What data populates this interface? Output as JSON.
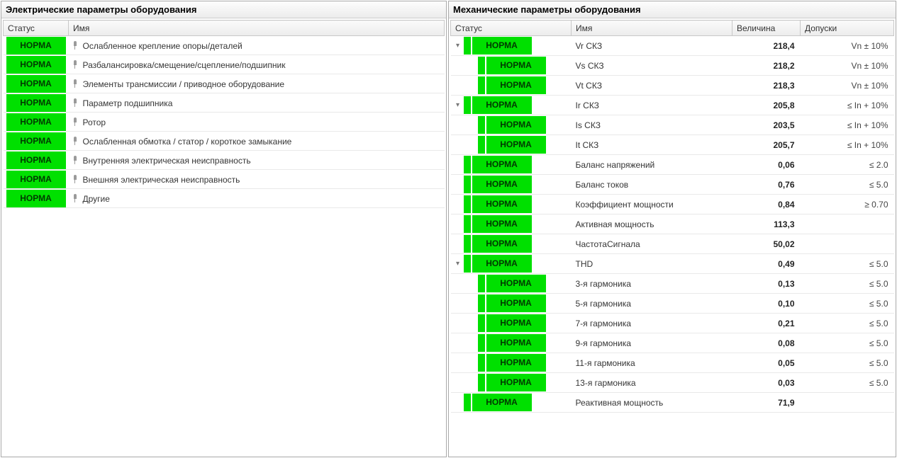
{
  "panels": {
    "left": {
      "title": "Электрические параметры оборудования",
      "columns": {
        "status": "Статус",
        "name": "Имя"
      },
      "status_label": "НОРМА",
      "rows": [
        {
          "name": "Ослабленное крепление опоры/деталей"
        },
        {
          "name": "Разбалансировка/смещение/сцепление/подшипник"
        },
        {
          "name": "Элементы трансмиссии / приводное оборудование"
        },
        {
          "name": "Параметр подшипника"
        },
        {
          "name": "Ротор"
        },
        {
          "name": "Ослабленная обмотка / статор / короткое замыкание"
        },
        {
          "name": "Внутренняя электрическая неисправность"
        },
        {
          "name": "Внешняя электрическая неисправность"
        },
        {
          "name": "Другие"
        }
      ]
    },
    "right": {
      "title": "Механические параметры оборудования",
      "columns": {
        "status": "Статус",
        "name": "Имя",
        "value": "Величина",
        "tolerance": "Допуски"
      },
      "status_label": "НОРМА",
      "rows": [
        {
          "level": 0,
          "expander": "open",
          "name": "Vr СКЗ",
          "value": "218,4",
          "tolerance": "Vn ± 10%"
        },
        {
          "level": 1,
          "expander": "",
          "name": "Vs СКЗ",
          "value": "218,2",
          "tolerance": "Vn ± 10%"
        },
        {
          "level": 1,
          "expander": "",
          "name": "Vt СКЗ",
          "value": "218,3",
          "tolerance": "Vn ± 10%"
        },
        {
          "level": 0,
          "expander": "open",
          "name": "Ir СКЗ",
          "value": "205,8",
          "tolerance": "≤ In + 10%"
        },
        {
          "level": 1,
          "expander": "",
          "name": "Is СКЗ",
          "value": "203,5",
          "tolerance": "≤ In + 10%"
        },
        {
          "level": 1,
          "expander": "",
          "name": "It СКЗ",
          "value": "205,7",
          "tolerance": "≤ In + 10%"
        },
        {
          "level": 0,
          "expander": "",
          "name": "Баланс напряжений",
          "value": "0,06",
          "tolerance": "≤ 2.0"
        },
        {
          "level": 0,
          "expander": "",
          "name": "Баланс токов",
          "value": "0,76",
          "tolerance": "≤ 5.0"
        },
        {
          "level": 0,
          "expander": "",
          "name": "Коэффициент мощности",
          "value": "0,84",
          "tolerance": "≥ 0.70"
        },
        {
          "level": 0,
          "expander": "",
          "name": "Активная мощность",
          "value": "113,3",
          "tolerance": ""
        },
        {
          "level": 0,
          "expander": "",
          "name": "ЧастотаСигнала",
          "value": "50,02",
          "tolerance": ""
        },
        {
          "level": 0,
          "expander": "open",
          "name": "THD",
          "value": "0,49",
          "tolerance": "≤ 5.0"
        },
        {
          "level": 1,
          "expander": "",
          "name": "3-я гармоника",
          "value": "0,13",
          "tolerance": "≤ 5.0"
        },
        {
          "level": 1,
          "expander": "",
          "name": "5-я гармоника",
          "value": "0,10",
          "tolerance": "≤ 5.0"
        },
        {
          "level": 1,
          "expander": "",
          "name": "7-я гармоника",
          "value": "0,21",
          "tolerance": "≤ 5.0"
        },
        {
          "level": 1,
          "expander": "",
          "name": "9-я гармоника",
          "value": "0,08",
          "tolerance": "≤ 5.0"
        },
        {
          "level": 1,
          "expander": "",
          "name": "11-я гармоника",
          "value": "0,05",
          "tolerance": "≤ 5.0"
        },
        {
          "level": 1,
          "expander": "",
          "name": "13-я гармоника",
          "value": "0,03",
          "tolerance": "≤ 5.0"
        },
        {
          "level": 0,
          "expander": "",
          "name": "Реактивная мощность",
          "value": "71,9",
          "tolerance": ""
        }
      ]
    }
  }
}
